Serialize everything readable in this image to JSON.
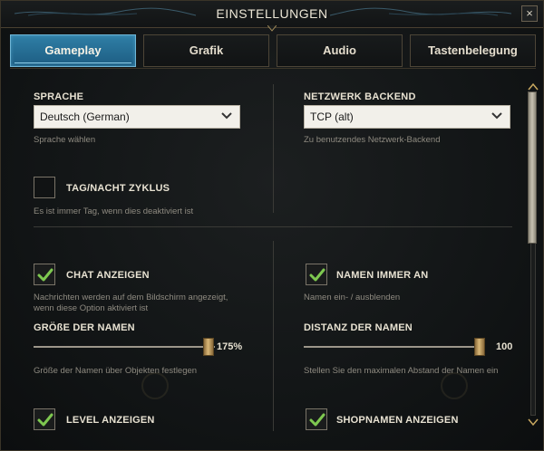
{
  "window": {
    "title": "EINSTELLUNGEN",
    "close_glyph": "×"
  },
  "tabs": [
    {
      "label": "Gameplay",
      "active": true
    },
    {
      "label": "Grafik",
      "active": false
    },
    {
      "label": "Audio",
      "active": false
    },
    {
      "label": "Tastenbelegung",
      "active": false
    }
  ],
  "settings": {
    "language": {
      "label": "SPRACHE",
      "value": "Deutsch (German)",
      "hint": "Sprache wählen"
    },
    "network": {
      "label": "NETZWERK BACKEND",
      "value": "TCP (alt)",
      "hint": "Zu benutzendes Netzwerk-Backend"
    },
    "day_night": {
      "label": "TAG/NACHT ZYKLUS",
      "checked": false,
      "hint": "Es ist immer Tag, wenn dies deaktiviert ist"
    },
    "show_chat": {
      "label": "CHAT ANZEIGEN",
      "checked": true,
      "hint_line1": "Nachrichten werden auf dem Bildschirm angezeigt,",
      "hint_line2": "wenn diese Option aktiviert ist"
    },
    "names_always": {
      "label": "NAMEN IMMER AN",
      "checked": true,
      "hint": "Namen ein- / ausblenden"
    },
    "name_size": {
      "label": "GRÖßE DER NAMEN",
      "value_text": "175%",
      "fraction": 1.0,
      "hint": "Größe der Namen über Objekten festlegen"
    },
    "name_distance": {
      "label": "DISTANZ DER NAMEN",
      "value_text": "100",
      "fraction": 1.0,
      "hint": "Stellen Sie den maximalen Abstand der Namen ein"
    },
    "show_level": {
      "label": "LEVEL ANZEIGEN",
      "checked": true
    },
    "show_shopnames": {
      "label": "SHOPNAMEN ANZEIGEN",
      "checked": true
    }
  },
  "icons": {
    "close": "close-icon",
    "dropdown": "chevron-down-icon",
    "check": "checkmark-icon",
    "scroll_up": "scroll-up-arrow-icon",
    "scroll_down": "scroll-down-arrow-icon"
  },
  "colors": {
    "accent_tab": "#2f7fa6",
    "check": "#7ec850",
    "slider_thumb": "#d9b878",
    "text": "#e8e2d2",
    "hint": "#8e8a80"
  }
}
